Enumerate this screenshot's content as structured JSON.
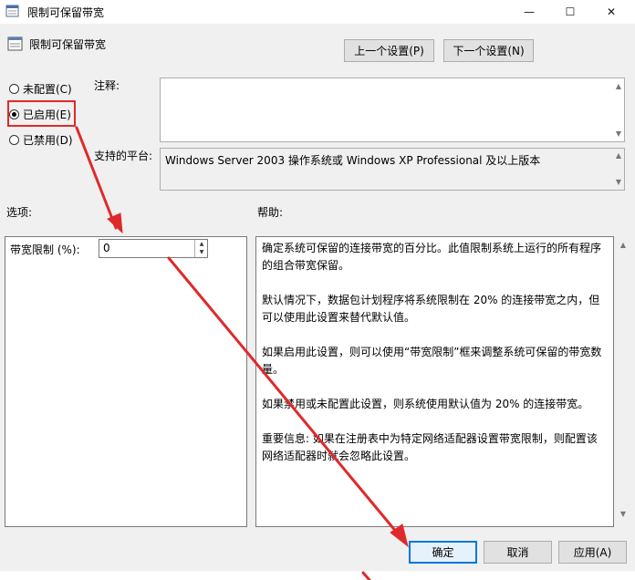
{
  "window": {
    "title": "限制可保留带宽",
    "min_glyph": "—",
    "max_glyph": "☐",
    "close_glyph": "✕"
  },
  "header": {
    "title": "限制可保留带宽"
  },
  "nav": {
    "prev": "上一个设置(P)",
    "next": "下一个设置(N)"
  },
  "state": {
    "not_configured": "未配置(C)",
    "enabled": "已启用(E)",
    "disabled": "已禁用(D)",
    "selected": "enabled"
  },
  "comment": {
    "label": "注释:",
    "value": ""
  },
  "platform": {
    "label": "支持的平台:",
    "value": "Windows Server 2003 操作系统或 Windows XP Professional 及以上版本"
  },
  "options": {
    "label": "选项:",
    "bandwidth_label": "带宽限制 (%):",
    "bandwidth_value": "0"
  },
  "help": {
    "label": "帮助:",
    "paragraphs": [
      "确定系统可保留的连接带宽的百分比。此值限制系统上运行的所有程序的组合带宽保留。",
      "默认情况下，数据包计划程序将系统限制在 20% 的连接带宽之内，但可以使用此设置来替代默认值。",
      "如果启用此设置，则可以使用“带宽限制”框来调整系统可保留的带宽数量。",
      "如果禁用或未配置此设置，则系统使用默认值为 20% 的连接带宽。",
      "重要信息: 如果在注册表中为特定网络适配器设置带宽限制，则配置该网络适配器时就会忽略此设置。"
    ]
  },
  "footer": {
    "ok": "确定",
    "cancel": "取消",
    "apply": "应用(A)"
  },
  "colors": {
    "annotation_red": "#e0292b",
    "accent_blue": "#0078d7"
  }
}
